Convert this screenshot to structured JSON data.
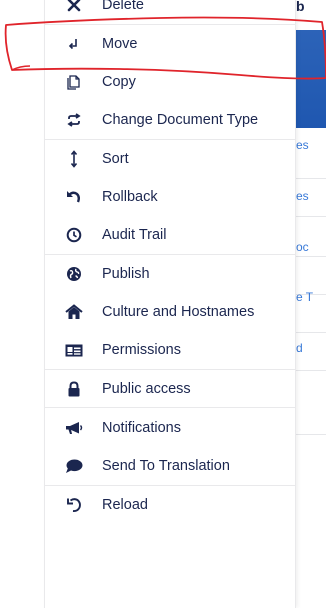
{
  "menu": {
    "items": [
      {
        "label": "Delete",
        "icon": "close-icon"
      },
      {
        "label": "Move",
        "icon": "move-arrow-icon"
      },
      {
        "label": "Copy",
        "icon": "copy-icon"
      },
      {
        "label": "Change Document Type",
        "icon": "swap-icon"
      },
      {
        "label": "Sort",
        "icon": "sort-arrows-icon"
      },
      {
        "label": "Rollback",
        "icon": "undo-icon"
      },
      {
        "label": "Audit Trail",
        "icon": "clock-icon"
      },
      {
        "label": "Publish",
        "icon": "globe-icon"
      },
      {
        "label": "Culture and Hostnames",
        "icon": "home-icon"
      },
      {
        "label": "Permissions",
        "icon": "id-card-icon"
      },
      {
        "label": "Public access",
        "icon": "lock-icon"
      },
      {
        "label": "Notifications",
        "icon": "megaphone-icon"
      },
      {
        "label": "Send To Translation",
        "icon": "speech-bubble-icon"
      },
      {
        "label": "Reload",
        "icon": "reload-icon"
      }
    ]
  },
  "background": {
    "top_fragment": "b",
    "row_fragments": [
      "es",
      "es",
      "oc",
      "e T",
      "d"
    ]
  },
  "colors": {
    "text": "#1b264f",
    "annotation": "#e0242b",
    "link": "#3879d8"
  }
}
